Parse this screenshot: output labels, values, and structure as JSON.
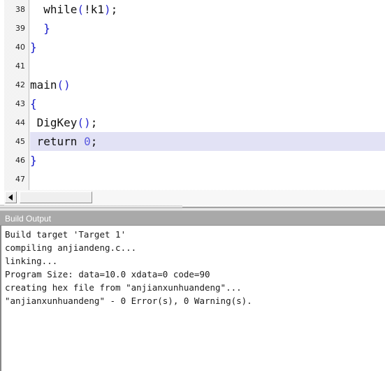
{
  "editor": {
    "gutter_icon": "line-number-gutter",
    "lines": [
      {
        "num": "38",
        "highlighted": false,
        "tokens": [
          {
            "t": "  while",
            "c": "plain"
          },
          {
            "t": "(",
            "c": "paren"
          },
          {
            "t": "!k1",
            "c": "plain"
          },
          {
            "t": ")",
            "c": "paren"
          },
          {
            "t": ";",
            "c": "plain"
          }
        ]
      },
      {
        "num": "39",
        "highlighted": false,
        "tokens": [
          {
            "t": "  ",
            "c": "plain"
          },
          {
            "t": "}",
            "c": "blue"
          }
        ]
      },
      {
        "num": "40",
        "highlighted": false,
        "tokens": [
          {
            "t": "}",
            "c": "blue"
          }
        ]
      },
      {
        "num": "41",
        "highlighted": false,
        "tokens": []
      },
      {
        "num": "42",
        "highlighted": false,
        "tokens": [
          {
            "t": "main",
            "c": "plain"
          },
          {
            "t": "()",
            "c": "paren"
          }
        ]
      },
      {
        "num": "43",
        "highlighted": false,
        "tokens": [
          {
            "t": "{",
            "c": "blue"
          }
        ]
      },
      {
        "num": "44",
        "highlighted": false,
        "tokens": [
          {
            "t": " DigKey",
            "c": "plain"
          },
          {
            "t": "()",
            "c": "paren"
          },
          {
            "t": ";",
            "c": "plain"
          }
        ]
      },
      {
        "num": "45",
        "highlighted": true,
        "tokens": [
          {
            "t": " return ",
            "c": "plain"
          },
          {
            "t": "0",
            "c": "num"
          },
          {
            "t": ";",
            "c": "plain"
          }
        ]
      },
      {
        "num": "46",
        "highlighted": false,
        "tokens": [
          {
            "t": "}",
            "c": "blue"
          }
        ]
      },
      {
        "num": "47",
        "highlighted": false,
        "tokens": []
      }
    ],
    "hscrollbar": {
      "left_button_icon": "scroll-left-arrow-icon"
    }
  },
  "build_output": {
    "title": "Build Output",
    "lines": [
      "Build target 'Target 1'",
      "compiling anjiandeng.c...",
      "linking...",
      "Program Size: data=10.0 xdata=0 code=90",
      "creating hex file from \"anjianxunhuandeng\"...",
      "\"anjianxunhuandeng\" - 0 Error(s), 0 Warning(s)."
    ]
  },
  "colors": {
    "highlight_line": "#e2e2f5",
    "keyword_blue": "#0f14c8",
    "titlebar_gray": "#a9a9a9",
    "gutter_gray": "#ebebeb"
  }
}
